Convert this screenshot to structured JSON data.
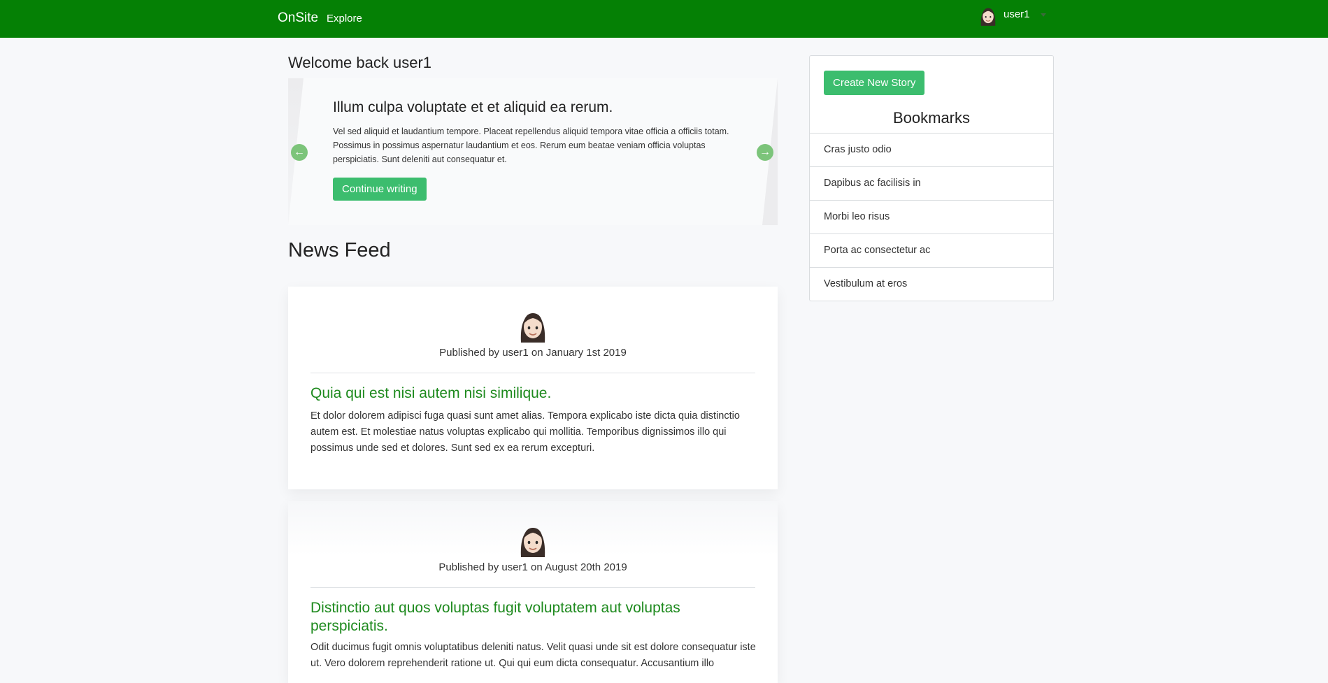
{
  "navbar": {
    "brand": "OnSite",
    "explore": "Explore",
    "username": "user1",
    "avatar_icon": "woman-avatar-icon",
    "background": "#058005"
  },
  "welcome": "Welcome back user1",
  "carousel": {
    "title": "Illum culpa voluptate et et aliquid ea rerum.",
    "text": "Vel sed aliquid et laudantium tempore. Placeat repellendus aliquid tempora vitae officia a officiis totam. Possimus in possimus aspernatur laudantium et eos. Rerum eum beatae veniam officia voluptas perspiciatis. Sunt deleniti aut consequatur et.",
    "button": "Continue writing",
    "prev_icon": "arrow-left-circle-icon",
    "next_icon": "arrow-right-circle-icon"
  },
  "news_feed": {
    "title": "News Feed",
    "posts": [
      {
        "meta": "Published by user1 on January 1st 2019",
        "title": "Quia qui est nisi autem nisi similique.",
        "text": " Et dolor dolorem adipisci fuga quasi sunt amet alias. Tempora explicabo iste dicta quia distinctio autem est. Et molestiae natus voluptas explicabo qui mollitia. Temporibus dignissimos illo qui possimus unde sed et dolores. Sunt sed ex ea rerum excepturi."
      },
      {
        "meta": "Published by user1 on August 20th 2019",
        "title": "Distinctio aut quos voluptas fugit voluptatem aut voluptas perspiciatis.",
        "text": " Odit ducimus fugit omnis voluptatibus deleniti natus. Velit quasi unde sit est dolore consequatur iste ut. Vero dolorem reprehenderit ratione ut. Qui qui eum dicta consequatur. Accusantium illo"
      }
    ]
  },
  "sidebar": {
    "create_button": "Create New Story",
    "bookmarks_title": "Bookmarks",
    "bookmarks": [
      "Cras justo odio",
      "Dapibus ac facilisis in",
      "Morbi leo risus",
      "Porta ac consectetur ac",
      "Vestibulum at eros"
    ]
  },
  "colors": {
    "brand_green": "#058005",
    "button_green": "#3cbd6e",
    "title_green": "#1e8a1e"
  }
}
